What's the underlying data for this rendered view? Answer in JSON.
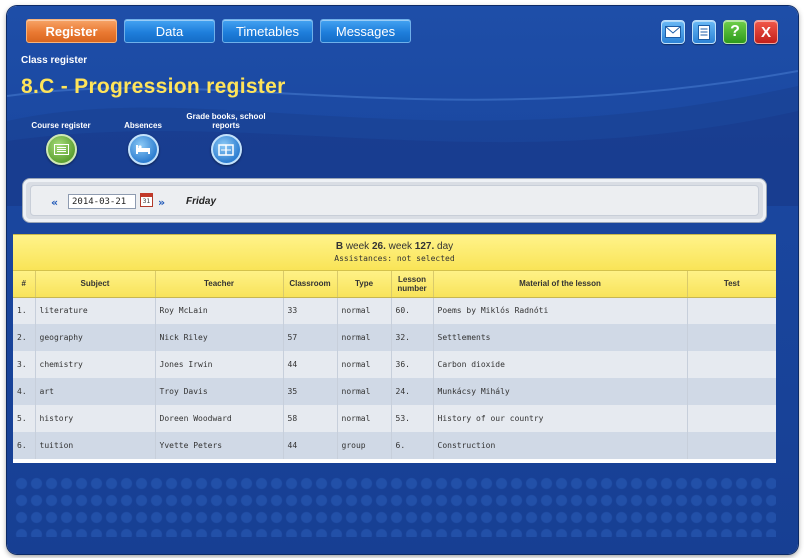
{
  "nav": {
    "tabs": [
      {
        "label": "Register",
        "active": true
      },
      {
        "label": "Data",
        "active": false
      },
      {
        "label": "Timetables",
        "active": false
      },
      {
        "label": "Messages",
        "active": false
      }
    ]
  },
  "toolbar": {
    "mail_icon": "envelope-icon",
    "doc_icon": "document-icon",
    "help_label": "?",
    "close_label": "X"
  },
  "header": {
    "subtitle": "Class register",
    "title": "8.C - Progression register"
  },
  "quick_links": [
    {
      "label": "Course register",
      "icon": "list-icon"
    },
    {
      "label": "Absences",
      "icon": "bed-icon"
    },
    {
      "label": "Grade books, school reports",
      "icon": "book-icon"
    }
  ],
  "date_bar": {
    "prev_label": "«",
    "next_label": "»",
    "date_value": "2014-03-21",
    "calendar_label": "31",
    "day": "Friday"
  },
  "week": {
    "type": "B",
    "text_week": "week",
    "week_num": "26.",
    "text_week2": "week",
    "day_num": "127.",
    "text_day": "day",
    "assistances": "Assistances: not selected"
  },
  "table": {
    "headers": [
      "#",
      "Subject",
      "Teacher",
      "Classroom",
      "Type",
      "Lesson number",
      "Material of the lesson",
      "Test"
    ],
    "rows": [
      [
        "1.",
        "literature",
        "Roy McLain",
        "33",
        "normal",
        "60.",
        "Poems by Miklós Radnóti",
        ""
      ],
      [
        "2.",
        "geography",
        "Nick Riley",
        "57",
        "normal",
        "32.",
        "Settlements",
        ""
      ],
      [
        "3.",
        "chemistry",
        "Jones Irwin",
        "44",
        "normal",
        "36.",
        "Carbon dioxide",
        ""
      ],
      [
        "4.",
        "art",
        "Troy Davis",
        "35",
        "normal",
        "24.",
        "Munkácsy Mihály",
        ""
      ],
      [
        "5.",
        "history",
        "Doreen Woodward",
        "58",
        "normal",
        "53.",
        "History of our country",
        ""
      ],
      [
        "6.",
        "tuition",
        "Yvette Peters",
        "44",
        "group",
        "6.",
        "Construction",
        ""
      ]
    ]
  }
}
